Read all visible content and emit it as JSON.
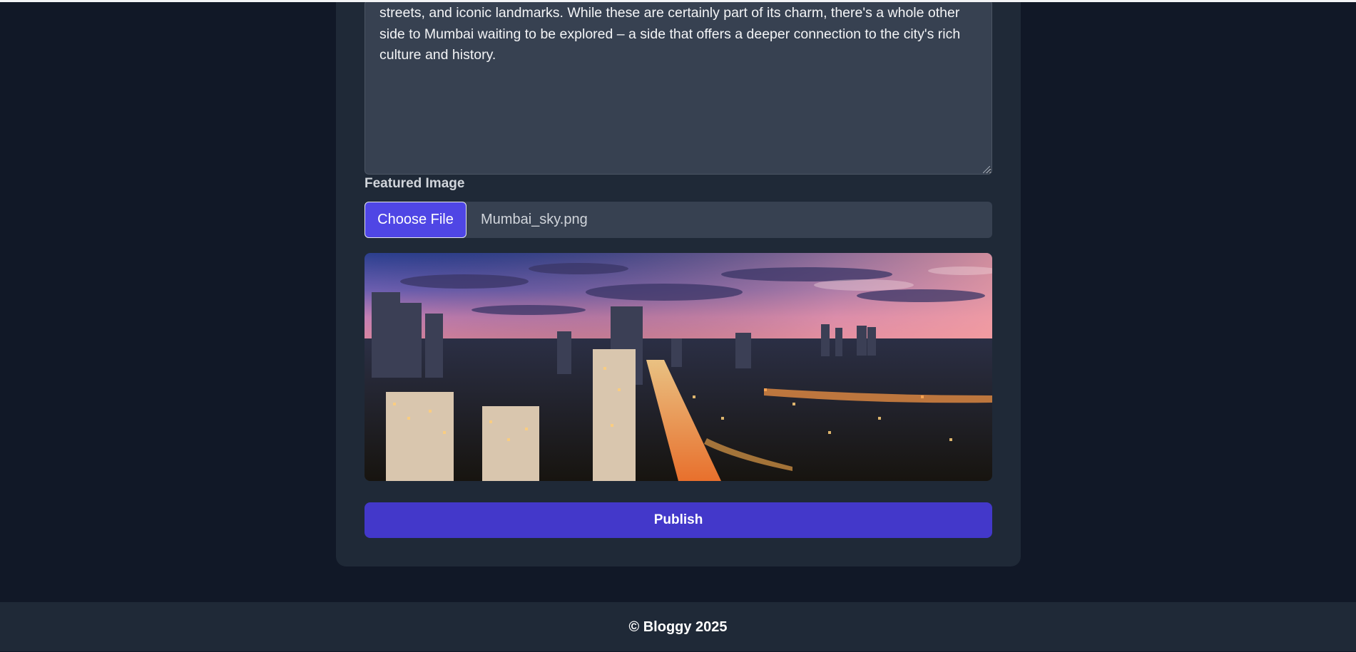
{
  "post_form": {
    "content_text": "streets, and iconic landmarks. While these are certainly part of its charm, there's a whole other side to Mumbai waiting to be explored – a side that offers a deeper connection to the city's rich culture and history.",
    "featured_image_label": "Featured Image",
    "choose_file_label": "Choose File",
    "file_name": "Mumbai_sky.png",
    "publish_label": "Publish"
  },
  "footer": {
    "text": "© Bloggy 2025"
  },
  "colors": {
    "page_bg": "#111827",
    "card_bg": "#1f2937",
    "input_bg": "#374151",
    "accent": "#4f46e5",
    "publish": "#4338ca"
  }
}
